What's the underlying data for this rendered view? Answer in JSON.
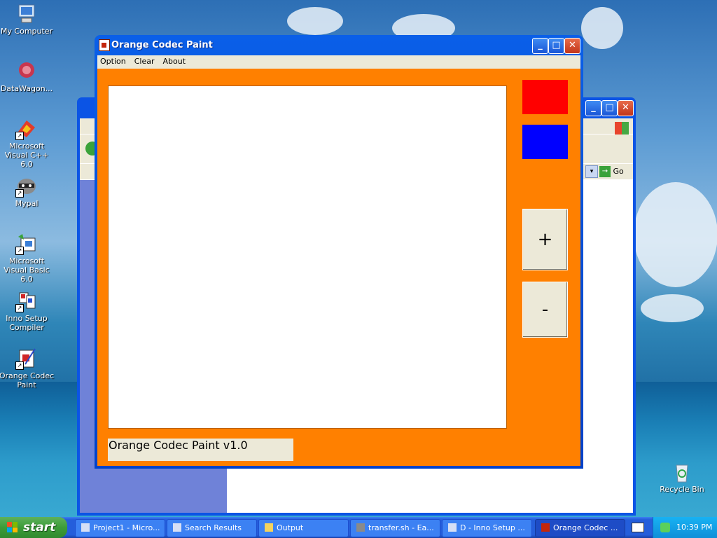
{
  "desktop": {
    "icons": [
      {
        "label": "My Computer"
      },
      {
        "label": "DataWagon..."
      },
      {
        "label": "Microsoft Visual C++ 6.0"
      },
      {
        "label": "Mypal"
      },
      {
        "label": "Microsoft Visual Basic 6.0"
      },
      {
        "label": "Inno Setup Compiler"
      },
      {
        "label": "Orange Codec Paint"
      },
      {
        "label": "Recycle Bin"
      }
    ]
  },
  "background_window": {
    "go_label": "Go"
  },
  "app": {
    "title": "Orange Codec Paint",
    "menu": [
      "Option",
      "Clear",
      "About"
    ],
    "colors": {
      "red": "#ff0000",
      "blue": "#0000ff",
      "background": "#ff8000"
    },
    "plus_label": "+",
    "minus_label": "-",
    "status": "Orange Codec Paint v1.0"
  },
  "taskbar": {
    "start_label": "start",
    "tasks": [
      {
        "label": "Project1 - Micro..."
      },
      {
        "label": "Search Results"
      },
      {
        "label": "Output"
      },
      {
        "label": "transfer.sh - Ea..."
      },
      {
        "label": "D - Inno Setup ..."
      },
      {
        "label": "Orange Codec ..."
      }
    ],
    "clock": "10:39 PM"
  }
}
